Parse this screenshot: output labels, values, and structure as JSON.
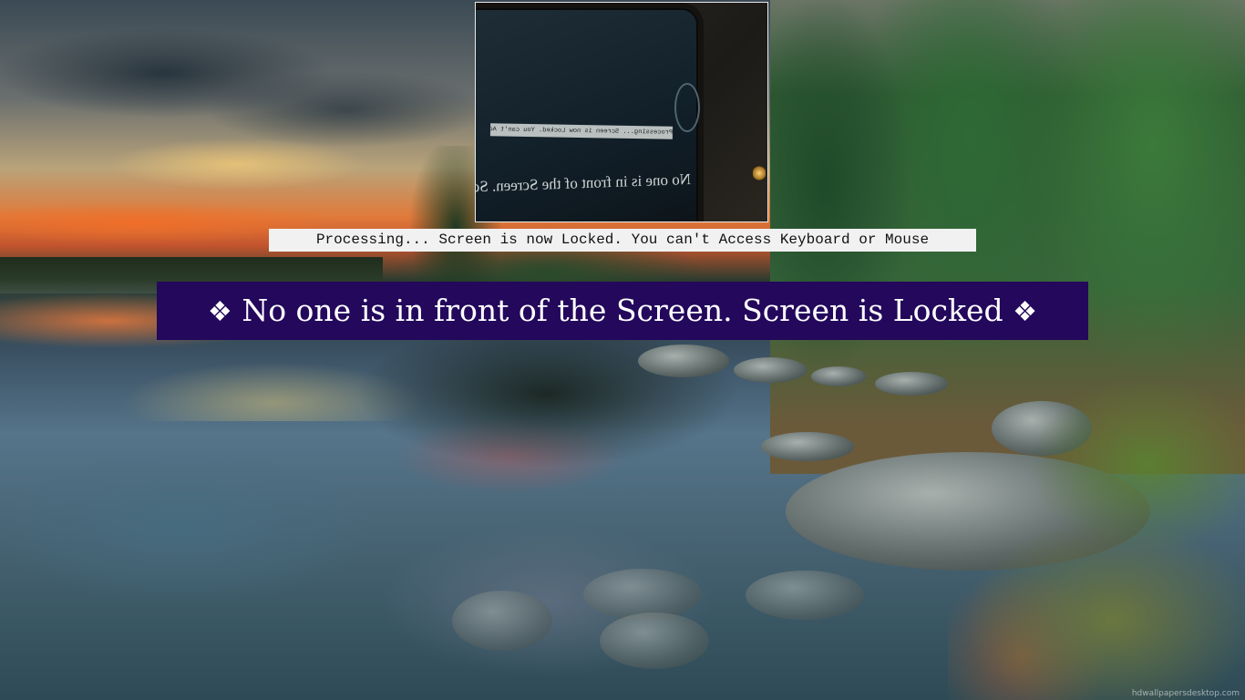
{
  "screen": {
    "background_description": "",
    "watermark": "hdwallpapersdesktop.com"
  },
  "webcam": {
    "caption_small": "Processing... Screen is now Locked. You can't Access Keyboard or Mouse",
    "caption_large": "No one is in front of the Screen. Screen is Locked"
  },
  "status": {
    "text": "Processing... Screen is now Locked. You can't Access Keyboard or Mouse"
  },
  "banner": {
    "prefix_symbol": "❖",
    "text": "No one is in front of the Screen. Screen is Locked",
    "suffix_symbol": "❖",
    "background_color": "#23085c",
    "text_color": "#ffffff"
  }
}
